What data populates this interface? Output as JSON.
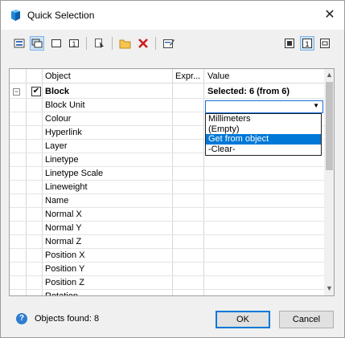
{
  "window": {
    "title": "Quick Selection",
    "close_glyph": "✕",
    "app_icon": "quick-selection-app-icon"
  },
  "toolbar": {
    "buttons": [
      {
        "name": "select-objects-icon"
      },
      {
        "name": "select-by-window-icon"
      },
      {
        "name": "rectangle-select-icon"
      },
      {
        "name": "select-one-icon"
      },
      {
        "name": "filter-icon"
      },
      {
        "name": "open-folder-icon"
      },
      {
        "name": "delete-x-icon"
      },
      {
        "name": "edit-icon"
      },
      {
        "name": "view-mode-1-icon"
      },
      {
        "name": "view-mode-2-icon"
      },
      {
        "name": "view-mode-3-icon"
      }
    ],
    "delete_color": "#cc1f1f",
    "folder_color": "#e0a830"
  },
  "grid": {
    "columns": {
      "object": "Object",
      "expression": "Expr...",
      "value": "Value"
    },
    "block_row": {
      "label": "Block",
      "value": "Selected: 6 (from 6)",
      "checked": "✔",
      "expander": "−"
    },
    "properties": [
      "Block Unit",
      "Colour",
      "Hyperlink",
      "Layer",
      "Linetype",
      "Linetype Scale",
      "Lineweight",
      "Name",
      "Normal X",
      "Normal Y",
      "Normal Z",
      "Position X",
      "Position Y",
      "Position Z",
      "Rotation"
    ],
    "combo": {
      "value": "",
      "arrow": "▼"
    },
    "dropdown_options": [
      "Millimeters",
      "(Empty)",
      "Get from object",
      "-Clear-"
    ],
    "dropdown_selected_index": 2,
    "scroll": {
      "up": "▲",
      "down": "▼"
    }
  },
  "status": {
    "help_glyph": "?",
    "objects_found": "Objects found: 8"
  },
  "buttons": {
    "ok": "OK",
    "cancel": "Cancel"
  },
  "colors": {
    "accent": "#0078d7",
    "help": "#2f7dd1"
  }
}
